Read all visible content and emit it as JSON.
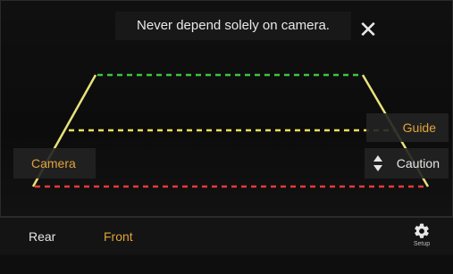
{
  "warning": {
    "text": "Never depend solely on camera."
  },
  "buttons": {
    "camera_label": "Camera",
    "guide_label": "Guide",
    "caution_label": "Caution"
  },
  "bottom_bar": {
    "rear_label": "Rear",
    "front_label": "Front",
    "setup_label": "Setup"
  },
  "icons": {
    "close": "close-icon",
    "caution": "up-down-arrows-icon",
    "setup": "gear-icon"
  },
  "colors": {
    "accent": "#e0a33a",
    "guide_far": "#3ec43e",
    "guide_mid": "#e8e05a",
    "guide_near": "#e63a3a",
    "guide_side": "#e9e27a",
    "background": "#0b0b0b"
  }
}
